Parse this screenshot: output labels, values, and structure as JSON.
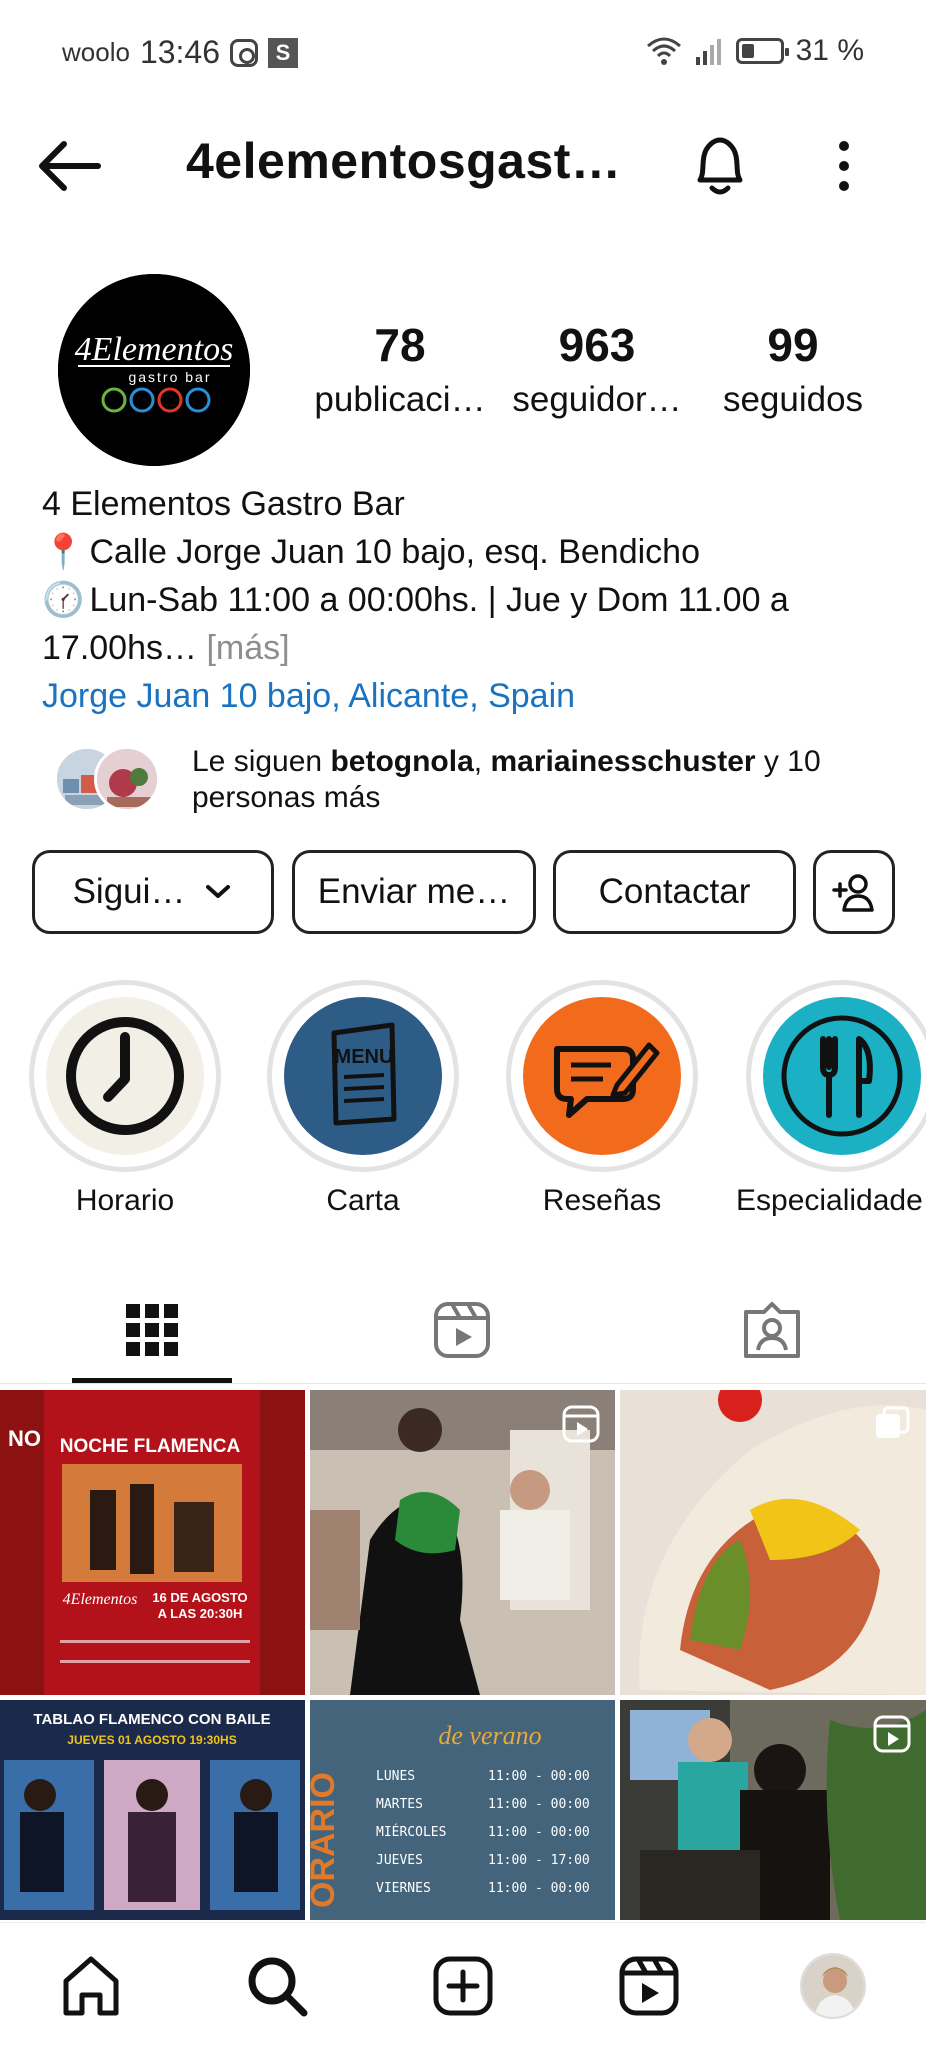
{
  "status_bar": {
    "carrier": "woolo",
    "time": "13:46",
    "battery": "31 %"
  },
  "header": {
    "username": "4elementosgast…"
  },
  "avatar": {
    "logo_text": "4Elementos",
    "logo_subtext": "gastro bar"
  },
  "stats": [
    {
      "value": "78",
      "label": "publicaci…"
    },
    {
      "value": "963",
      "label": "seguidor…"
    },
    {
      "value": "99",
      "label": "seguidos"
    }
  ],
  "bio": {
    "name": "4 Elementos Gastro Bar",
    "line1_icon": "📍",
    "line1": "Calle Jorge Juan 10 bajo, esq. Bendicho",
    "line2_icon": "🕜",
    "line2": "Lun-Sab 11:00 a 00:00hs. | Jue y Dom 11.00 a",
    "line3": "17.00hs…",
    "more": "[más]",
    "location": "Jorge Juan 10 bajo, Alicante, Spain"
  },
  "followed_by": {
    "prefix": "Le siguen ",
    "user1": "betognola",
    "sep": ", ",
    "user2": "mariainesschuster",
    "suffix": " y 10 personas más"
  },
  "actions": {
    "following": "Sigui…",
    "message": "Enviar me…",
    "contact": "Contactar"
  },
  "highlights": [
    {
      "label": "Horario",
      "icon": "clock-icon",
      "color": "#f2f0e6"
    },
    {
      "label": "Carta",
      "icon": "menu-icon",
      "color": "#2d5d87",
      "text": "MENU"
    },
    {
      "label": "Reseñas",
      "icon": "review-icon",
      "color": "#f26b1d"
    },
    {
      "label": "Especialidade",
      "icon": "cutlery-icon",
      "color": "#1cb0c4"
    }
  ],
  "grid": {
    "post1": {
      "title": "NOCHE FLAMENCA",
      "brand": "4Elementos",
      "date": "16 DE AGOSTO",
      "time": "A LAS 20:30H",
      "side": "NO"
    },
    "post4": {
      "title": "TABLAO FLAMENCO CON BAILE",
      "subtitle": "JUEVES 01 AGOSTO 19:30HS"
    },
    "post5": {
      "heading": "de verano",
      "side": "ORARIO",
      "rows": [
        {
          "day": "LUNES",
          "hours": "11:00 - 00:00"
        },
        {
          "day": "MARTES",
          "hours": "11:00 - 00:00"
        },
        {
          "day": "MIÉRCOLES",
          "hours": "11:00 - 00:00"
        },
        {
          "day": "JUEVES",
          "hours": "11:00 - 17:00"
        },
        {
          "day": "VIERNES",
          "hours": "11:00 - 00:00"
        }
      ]
    }
  },
  "colors": {
    "link": "#1a73c2",
    "muted": "#8e8e8e",
    "accent_red": "#c4161c"
  }
}
